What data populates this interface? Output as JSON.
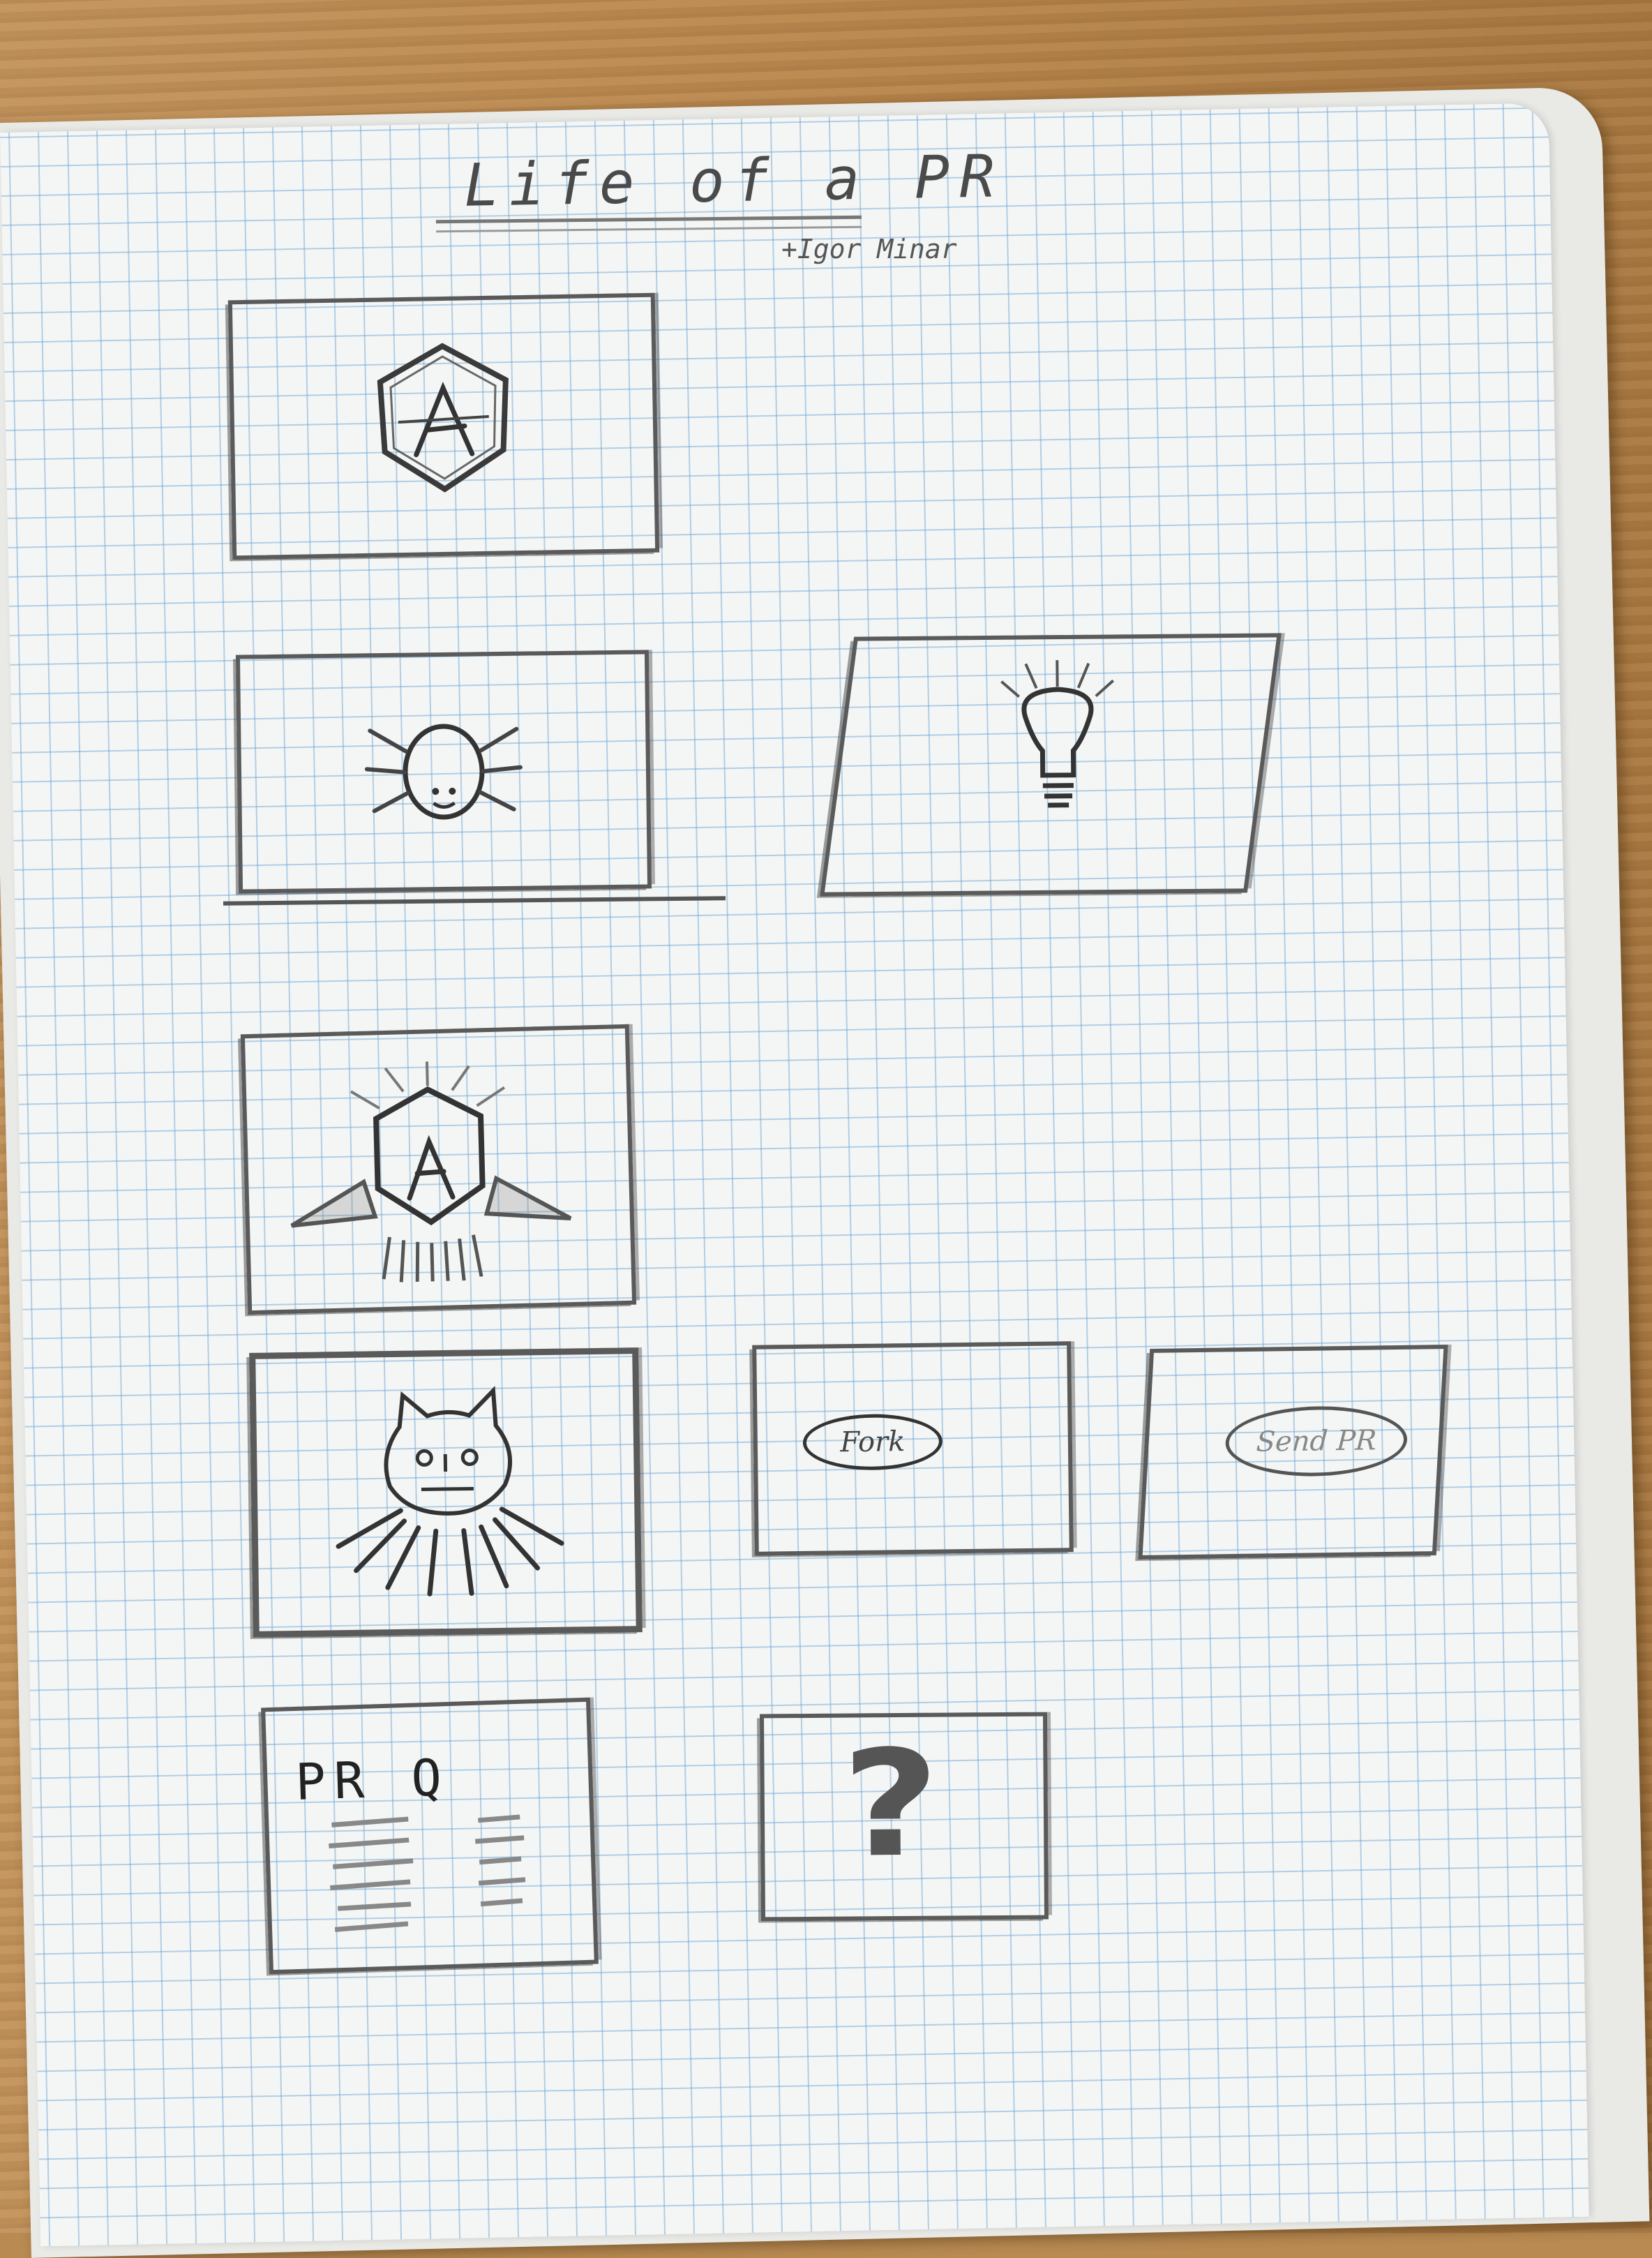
{
  "notebook": {
    "title": "Life of a PR",
    "author": "+Igor Minar"
  },
  "storyboard": {
    "panel_fork": {
      "button_label": "Fork"
    },
    "panel_send_pr": {
      "button_label": "Send PR"
    },
    "panel_pr_queue": {
      "heading": "PR Q"
    },
    "panel_question": {
      "symbol": "?"
    }
  },
  "colors": {
    "pencil": "#4a4a4a",
    "grid": "#6ea5d2",
    "paper": "#f4f6f5",
    "wood": "#b98a52"
  }
}
